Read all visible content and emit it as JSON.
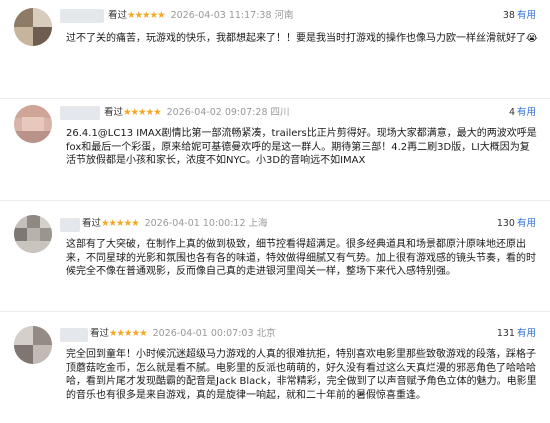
{
  "reviews": [
    {
      "tag": "看过",
      "stars": "★★★★★",
      "date": "2026-04-03 11:17:38",
      "location": "河南",
      "useful_count": "38",
      "useful_label": "有用",
      "content": "过不了关的痛苦，玩游戏的快乐，我都想起来了！！要是我当时打游戏的操作也像马力欧一样丝滑就好了😭"
    },
    {
      "tag": "看过",
      "stars": "★★★★★",
      "date": "2026-04-02 09:07:28",
      "location": "四川",
      "useful_count": "4",
      "useful_label": "有用",
      "content": "26.4.1@LC13 IMAX剧情比第一部流畅紧凑，trailers比正片剪得好。现场大家都满意，最大的两波欢呼是fox和最后一个彩蛋，原来给妮可基德曼欢呼的是这一群人。期待第三部！4.2再二刷3D版，LI大概因为复活节放假都是小孩和家长，浓度不如NYC。小3D的音响远不如IMAX"
    },
    {
      "tag": "看过",
      "stars": "★★★★★",
      "date": "2026-04-01 10:00:12",
      "location": "上海",
      "useful_count": "130",
      "useful_label": "有用",
      "content": "这部有了大突破，在制作上真的做到极致，细节控看得超满足。很多经典道具和场景都原汁原味地还原出来，不同星球的光影和氛围也各有各的味道，特效做得细腻又有气势。加上很有游戏感的镜头节奏，看的时候完全不像在普通观影，反而像自己真的走进银河里闯关一样，整场下来代入感特别强。"
    },
    {
      "tag": "看过",
      "stars": "★★★★★",
      "date": "2026-04-01 00:07:03",
      "location": "北京",
      "useful_count": "131",
      "useful_label": "有用",
      "content": "完全回到童年！小时候沉迷超级马力游戏的人真的很难抗拒，特别喜欢电影里那些致敬游戏的段落，踩格子顶蘑菇吃金币，怎么就是看不腻。电影里的反派也萌萌的，好久没有看过这么天真烂漫的邪恶角色了哈哈哈哈，看到片尾才发现酷霸的配音是Jack Black，非常精彩，完全做到了以声音赋予角色立体的魅力。电影里的音乐也有很多是来自游戏，真的是旋律一响起，就和二十年前的暑假惊喜重逢。"
    }
  ]
}
